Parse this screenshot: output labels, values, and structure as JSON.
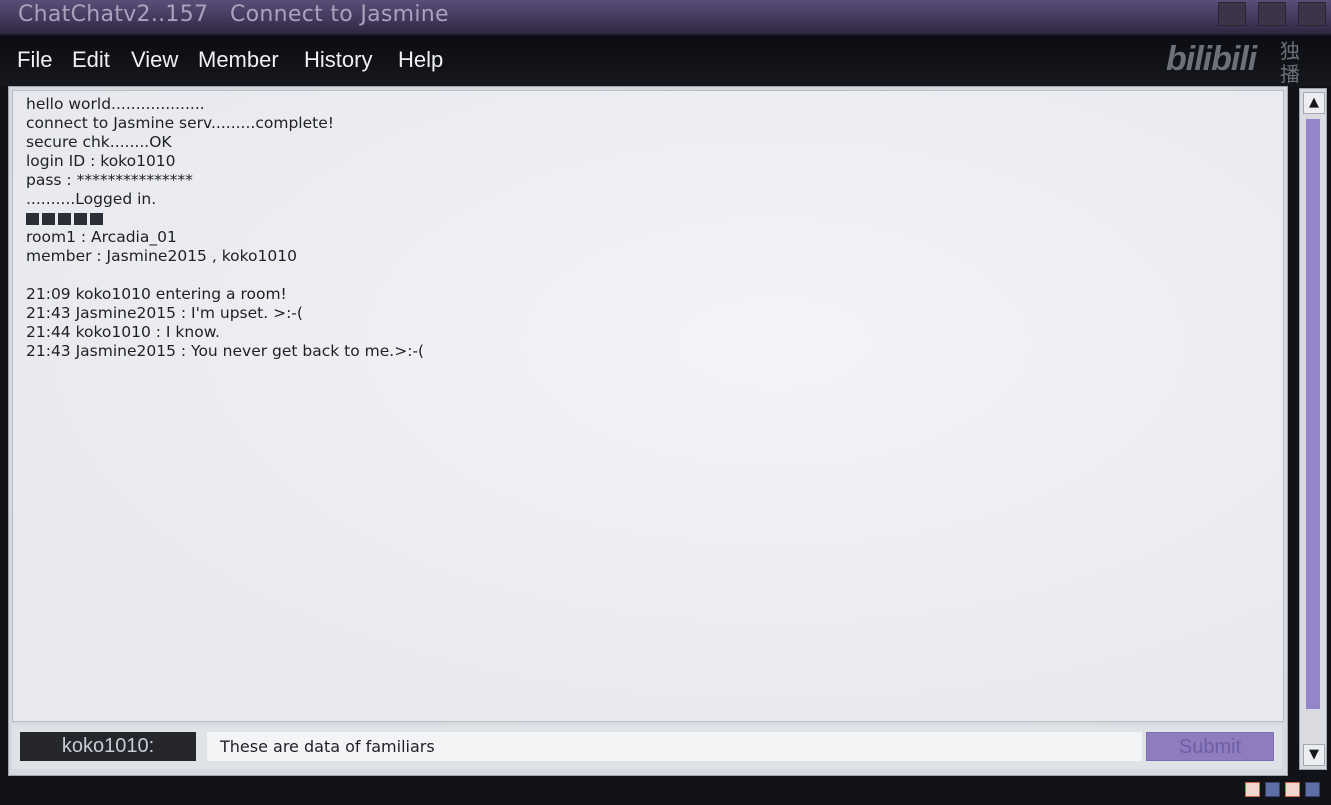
{
  "window": {
    "app_title": "ChatChatv2..157",
    "connection_title": "Connect to Jasmine"
  },
  "menu": {
    "items": [
      "File",
      "Edit",
      "View",
      "Member",
      "History",
      "Help"
    ]
  },
  "watermark": {
    "logo": "bilibili",
    "tag": "独播"
  },
  "chat_log": {
    "lines": [
      "hello world...................",
      "connect to Jasmine serv.........complete!",
      "secure chk........OK",
      "login ID : koko1010",
      "pass : ***************",
      "..........Logged in.",
      "",
      "room1 : Arcadia_01",
      "member : Jasmine2015 , koko1010",
      "",
      "21:09 koko1010 entering a room!",
      "21:43 Jasmine2015 : I'm upset. >:-(",
      "21:44 koko1010 : I know.",
      "21:43 Jasmine2015 : You never get back to me.>:-("
    ],
    "progress_blocks_filled": 5
  },
  "input": {
    "nickname": "koko1010:",
    "message_value": "These are data of familiars",
    "submit_label": "Submit"
  },
  "colors": {
    "title_bar": "#41375a",
    "accent": "#8f7cbf",
    "log_background": "#eef0f3"
  },
  "icons": {
    "scroll_up": "up-arrow-icon",
    "scroll_down": "down-arrow-icon"
  }
}
